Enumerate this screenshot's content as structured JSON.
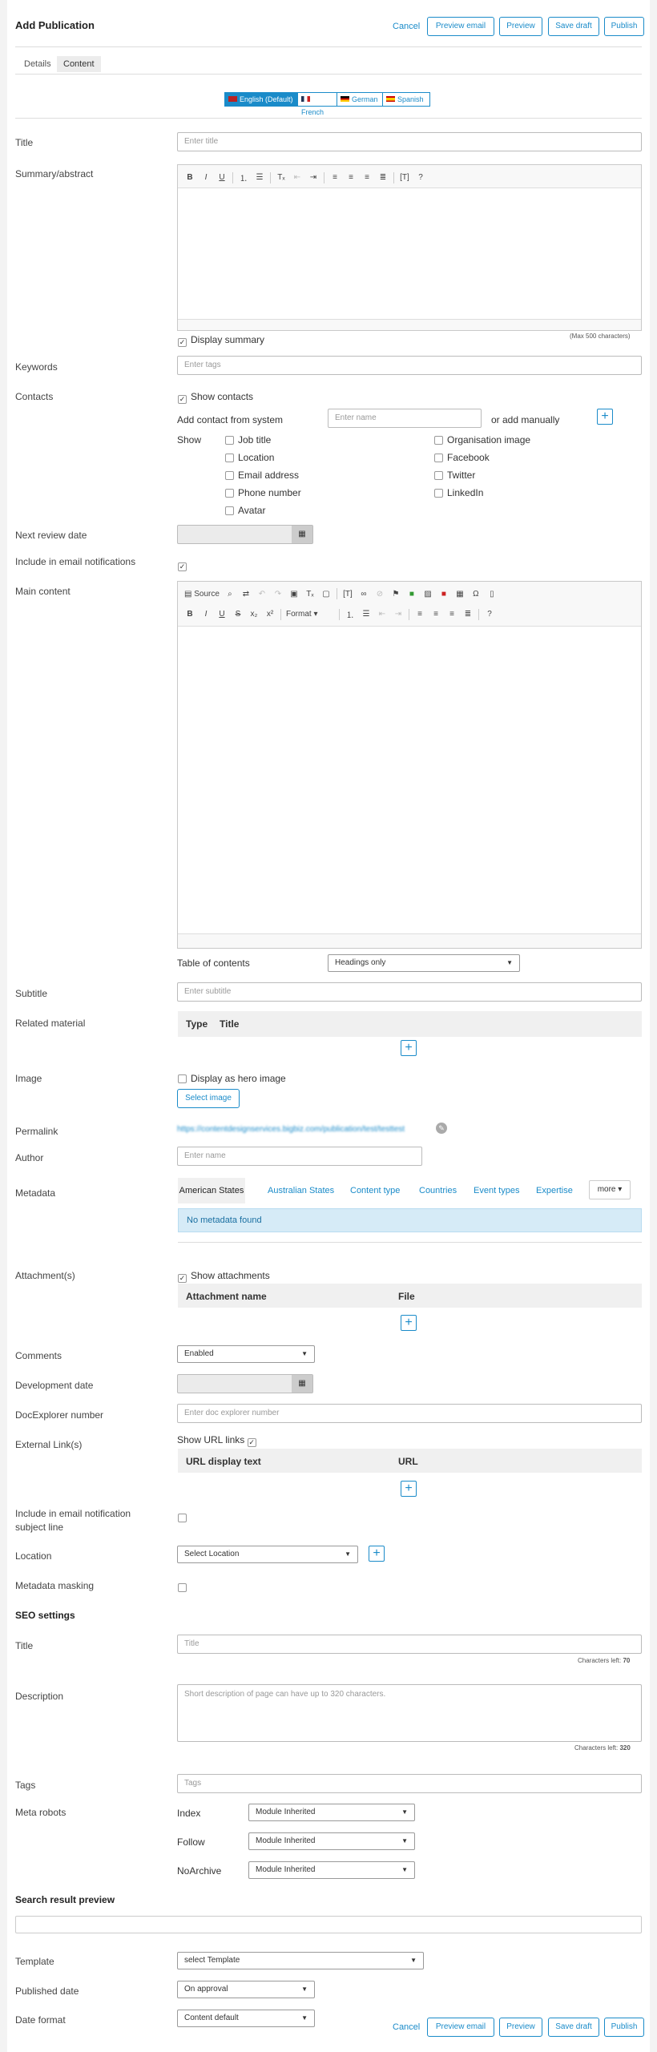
{
  "header": {
    "title": "Add Publication",
    "cancel": "Cancel",
    "preview_email": "Preview email",
    "preview": "Preview",
    "save_draft": "Save draft",
    "publish": "Publish"
  },
  "tabs": [
    "Details",
    "Content"
  ],
  "languages": [
    "English (Default)",
    "French",
    "German",
    "Spanish"
  ],
  "title": {
    "label": "Title",
    "placeholder": "Enter title"
  },
  "summary": {
    "label": "Summary/abstract",
    "max_note": "(Max 500 characters)",
    "display_summary": "Display summary"
  },
  "keywords": {
    "label": "Keywords",
    "placeholder": "Enter tags"
  },
  "contacts": {
    "label": "Contacts",
    "show_contacts": "Show contacts",
    "add_from_system": "Add contact from system",
    "name_placeholder": "Enter name",
    "or_add_manually": "or add manually",
    "show": "Show",
    "options_left": [
      "Job title",
      "Location",
      "Email address",
      "Phone number",
      "Avatar"
    ],
    "options_right": [
      "Organisation image",
      "Facebook",
      "Twitter",
      "LinkedIn"
    ]
  },
  "next_review_date": {
    "label": "Next review date"
  },
  "include_email": {
    "label": "Include in email notifications"
  },
  "main_content": {
    "label": "Main content",
    "source": "Source",
    "format": "Format",
    "toc_label": "Table of contents",
    "toc_value": "Headings only"
  },
  "subtitle": {
    "label": "Subtitle",
    "placeholder": "Enter subtitle"
  },
  "related": {
    "label": "Related material",
    "col_type": "Type",
    "col_title": "Title"
  },
  "image": {
    "label": "Image",
    "hero": "Display as hero image",
    "select": "Select image"
  },
  "permalink": {
    "label": "Permalink",
    "value": "https://contentdesignservices.bigbiz.com/publication/test/testtest"
  },
  "author": {
    "label": "Author",
    "placeholder": "Enter name"
  },
  "metadata": {
    "label": "Metadata",
    "tabs": [
      "American States",
      "Australian States",
      "Content type",
      "Countries",
      "Event types",
      "Expertise"
    ],
    "more": "more",
    "empty": "No metadata found"
  },
  "attachments": {
    "label": "Attachment(s)",
    "show": "Show attachments",
    "col_name": "Attachment name",
    "col_file": "File"
  },
  "comments": {
    "label": "Comments",
    "value": "Enabled"
  },
  "development_date": {
    "label": "Development date"
  },
  "docexplorer": {
    "label": "DocExplorer number",
    "placeholder": "Enter doc explorer number"
  },
  "external_links": {
    "label": "External Link(s)",
    "show": "Show URL links",
    "col_text": "URL display text",
    "col_url": "URL"
  },
  "email_subject": {
    "label_1": "Include in email notification",
    "label_2": "subject line"
  },
  "location": {
    "label": "Location",
    "value": "Select Location"
  },
  "metadata_masking": {
    "label": "Metadata masking"
  },
  "seo": {
    "heading": "SEO settings",
    "title_label": "Title",
    "title_placeholder": "Title",
    "title_chars": "Characters left:",
    "title_count": "70",
    "desc_label": "Description",
    "desc_placeholder": "Short description of page can have up to 320 characters.",
    "desc_chars": "Characters left:",
    "desc_count": "320",
    "tags_label": "Tags",
    "tags_placeholder": "Tags",
    "robots_label": "Meta robots",
    "robots": [
      {
        "name": "Index",
        "value": "Module Inherited"
      },
      {
        "name": "Follow",
        "value": "Module Inherited"
      },
      {
        "name": "NoArchive",
        "value": "Module Inherited"
      }
    ]
  },
  "search_preview": {
    "heading": "Search result preview"
  },
  "template": {
    "label": "Template",
    "value": "select Template"
  },
  "published_date": {
    "label": "Published date",
    "value": "On approval"
  },
  "date_format": {
    "label": "Date format",
    "value": "Content default"
  },
  "colors": {
    "accent": "#1a8bc9",
    "info_bg": "#d6ebf7"
  }
}
